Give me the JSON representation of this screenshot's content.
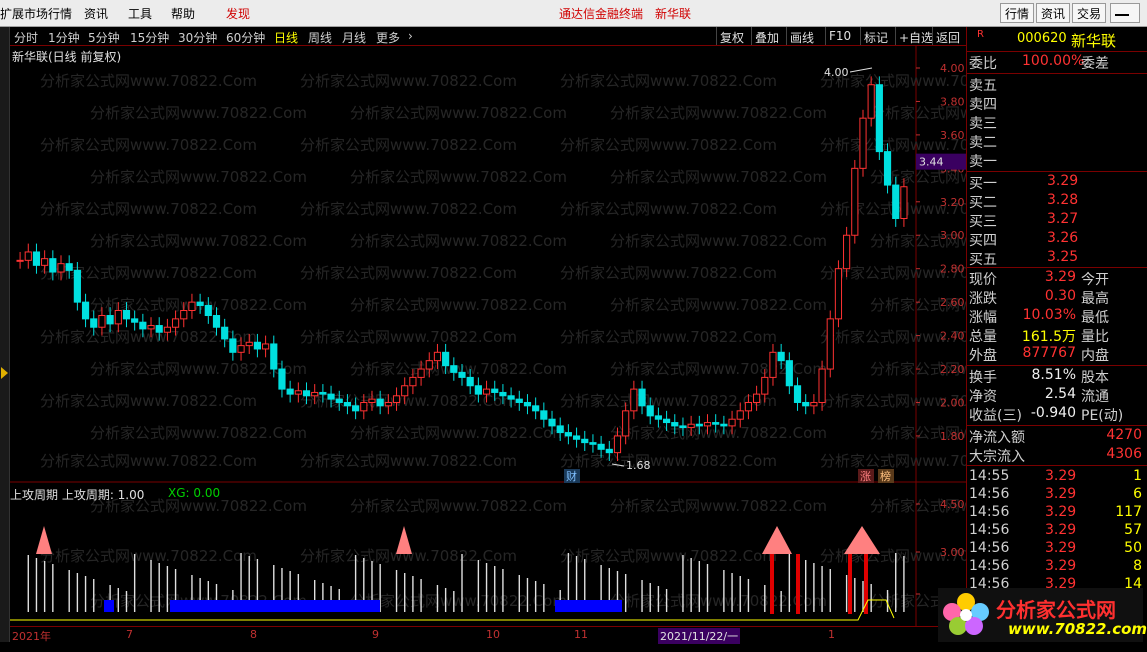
{
  "menu": {
    "left_items": [
      "扩展市场行情",
      "资讯",
      "工具",
      "帮助",
      "发现"
    ],
    "center_items": [
      "通达信金融终端",
      "新华联"
    ],
    "right_buttons": [
      "行情",
      "资讯",
      "交易"
    ]
  },
  "toolbar": {
    "periods": [
      "分时",
      "1分钟",
      "5分钟",
      "15分钟",
      "30分钟",
      "60分钟",
      "日线",
      "周线",
      "月线",
      "更多"
    ],
    "active_period": "日线",
    "buttons": [
      "复权",
      "叠加",
      "画线",
      "F10",
      "标记",
      "+自选",
      "返回"
    ]
  },
  "chart_title": "新华联(日线 前复权)",
  "indicator_title": "上攻周期 上攻周期: 1.00",
  "indicator_xg": "XG: 0.00",
  "watermark": "分析家公式网www.70822.Com",
  "price_axis": [
    "4.00",
    "3.80",
    "3.60",
    "3.40",
    "3.20",
    "3.00",
    "2.80",
    "2.60",
    "2.40",
    "2.20",
    "2.00",
    "1.80"
  ],
  "indicator_axis": [
    "4.50",
    "3.00",
    "1.50"
  ],
  "price_cursor": "3.44",
  "high_marker": "4.00",
  "low_marker": "1.68",
  "event_tags": [
    "财",
    "涨",
    "榜"
  ],
  "date_axis": [
    "2021年",
    "7",
    "8",
    "9",
    "10",
    "11",
    "2021/11/22/一",
    "1"
  ],
  "quote": {
    "code": "000620",
    "name": "新华联",
    "weibi_label": "委比",
    "weibi_value": "100.00%",
    "weicha_label": "委差",
    "sells": [
      "卖五",
      "卖四",
      "卖三",
      "卖二",
      "卖一"
    ],
    "buys": [
      {
        "label": "买一",
        "price": "3.29"
      },
      {
        "label": "买二",
        "price": "3.28"
      },
      {
        "label": "买三",
        "price": "3.27"
      },
      {
        "label": "买四",
        "price": "3.26"
      },
      {
        "label": "买五",
        "price": "3.25"
      }
    ],
    "stats": [
      {
        "label": "现价",
        "value": "3.29",
        "label2": "今开",
        "color": "red"
      },
      {
        "label": "涨跌",
        "value": "0.30",
        "label2": "最高",
        "color": "red"
      },
      {
        "label": "涨幅",
        "value": "10.03%",
        "label2": "最低",
        "color": "red"
      },
      {
        "label": "总量",
        "value": "161.5万",
        "label2": "量比",
        "color": "yel"
      },
      {
        "label": "外盘",
        "value": "877767",
        "label2": "内盘",
        "color": "red"
      }
    ],
    "stats2": [
      {
        "label": "换手",
        "value": "8.51%",
        "label2": "股本",
        "color": "white"
      },
      {
        "label": "净资",
        "value": "2.54",
        "label2": "流通",
        "color": "white"
      },
      {
        "label": "收益(三)",
        "value": "-0.940",
        "label2": "PE(动)",
        "color": "white"
      }
    ],
    "flows": [
      {
        "label": "净流入额",
        "value": "4270"
      },
      {
        "label": "大宗流入",
        "value": "4306"
      }
    ],
    "ticks": [
      {
        "time": "14:55",
        "price": "3.29",
        "vol": "1"
      },
      {
        "time": "14:56",
        "price": "3.29",
        "vol": "6"
      },
      {
        "time": "14:56",
        "price": "3.29",
        "vol": "117"
      },
      {
        "time": "14:56",
        "price": "3.29",
        "vol": "57"
      },
      {
        "time": "14:56",
        "price": "3.29",
        "vol": "50"
      },
      {
        "time": "14:56",
        "price": "3.29",
        "vol": "8"
      },
      {
        "time": "14:56",
        "price": "3.29",
        "vol": "14"
      }
    ]
  },
  "logo": {
    "title": "分析家公式网",
    "url": "www.70822.com"
  },
  "colors": {
    "up": "#ff3232",
    "down": "#00e0e0",
    "accent": "#ffff00",
    "frame": "#7a0000",
    "signal_fill": "#0000ff",
    "peak_fill": "#ff8080"
  }
}
